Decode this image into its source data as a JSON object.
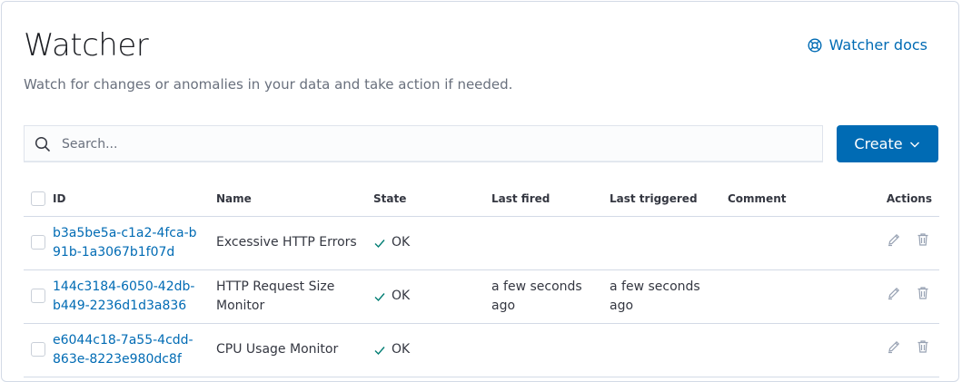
{
  "header": {
    "title": "Watcher",
    "docs_link": "Watcher docs",
    "subtitle": "Watch for changes or anomalies in your data and take action if needed."
  },
  "search": {
    "placeholder": "Search..."
  },
  "create_button": {
    "label": "Create"
  },
  "table": {
    "columns": {
      "id": "ID",
      "name": "Name",
      "state": "State",
      "last_fired": "Last fired",
      "last_triggered": "Last triggered",
      "comment": "Comment",
      "actions": "Actions"
    },
    "rows": [
      {
        "id": "b3a5be5a-c1a2-4fca-b91b-1a3067b1f07d",
        "name": "Excessive HTTP Errors",
        "state": "OK",
        "last_fired": "",
        "last_triggered": "",
        "comment": ""
      },
      {
        "id": "144c3184-6050-42db-b449-2236d1d3a836",
        "name": "HTTP Request Size Monitor",
        "state": "OK",
        "last_fired": "a few seconds ago",
        "last_triggered": "a few seconds ago",
        "comment": ""
      },
      {
        "id": "e6044c18-7a55-4cdd-863e-8223e980dc8f",
        "name": "CPU Usage Monitor",
        "state": "OK",
        "last_fired": "",
        "last_triggered": "",
        "comment": ""
      }
    ]
  },
  "icons": {
    "docs": "help-lifebuoy-icon",
    "search": "search-icon",
    "create_dropdown": "chevron-down-icon",
    "state_ok": "check-icon",
    "edit": "pencil-icon",
    "delete": "trash-icon"
  },
  "colors": {
    "link": "#006bb4",
    "primary_button": "#006bb4",
    "ok_check": "#017d73",
    "border": "#d3dae6"
  }
}
